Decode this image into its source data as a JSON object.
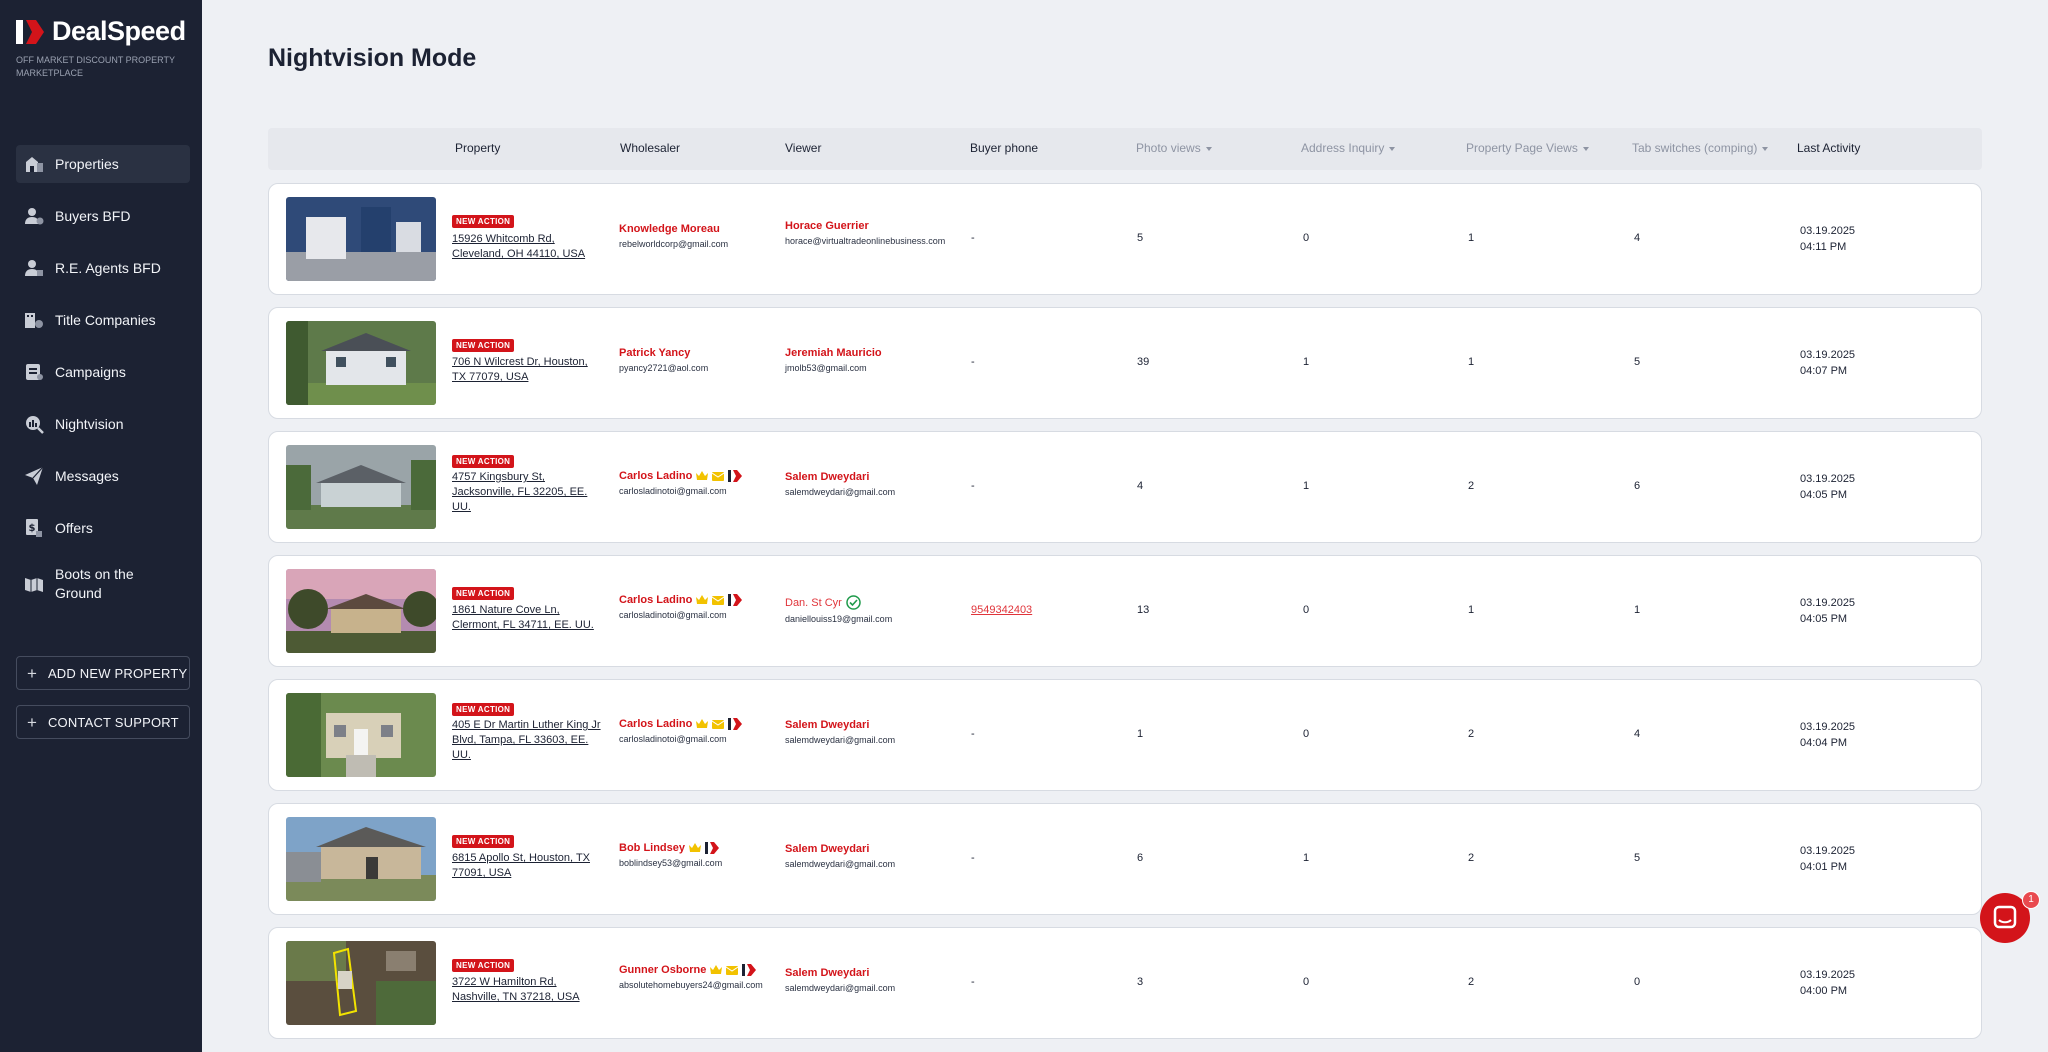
{
  "app": {
    "name": "DealSpeed",
    "tagline": "OFF MARKET DISCOUNT PROPERTY MARKETPLACE",
    "brand_color": "#d3141a",
    "sidebar_color": "#1c2233"
  },
  "sidebar": {
    "items": [
      {
        "label": "Properties",
        "icon": "properties-icon"
      },
      {
        "label": "Buyers BFD",
        "icon": "buyers-icon"
      },
      {
        "label": "R.E. Agents BFD",
        "icon": "agents-icon"
      },
      {
        "label": "Title Companies",
        "icon": "title-companies-icon"
      },
      {
        "label": "Campaigns",
        "icon": "campaigns-icon"
      },
      {
        "label": "Nightvision",
        "icon": "nightvision-icon"
      },
      {
        "label": "Messages",
        "icon": "messages-icon"
      },
      {
        "label": "Offers",
        "icon": "offers-icon"
      },
      {
        "label": "Boots on the Ground",
        "icon": "boots-icon"
      }
    ],
    "add_property": "ADD NEW PROPERTY",
    "contact_support": "CONTACT SUPPORT"
  },
  "page": {
    "title": "Nightvision Mode"
  },
  "table": {
    "headers": {
      "property": "Property",
      "wholesaler": "Wholesaler",
      "viewer": "Viewer",
      "buyer_phone": "Buyer phone",
      "photo_views": "Photo views",
      "address_inquiry": "Address Inquiry",
      "page_views": "Property Page Views",
      "tab_switches": "Tab switches (comping)",
      "last_activity": "Last Activity"
    },
    "rows": [
      {
        "badge": "NEW ACTION",
        "address": "15926 Whitcomb Rd, Cleveland, OH 44110, USA",
        "wholesaler": "Knowledge Moreau",
        "wholesaler_email": "rebelworldcorp@gmail.com",
        "viewer": "Horace Guerrier",
        "viewer_email": "horace@virtualtradeonlinebusiness.com",
        "phone": "-",
        "photo_views": "5",
        "address_inquiry": "0",
        "page_views": "1",
        "tab_switches": "4",
        "date": "03.19.2025",
        "time": "04:11 PM"
      },
      {
        "badge": "NEW ACTION",
        "address": "706 N Wilcrest Dr, Houston, TX 77079, USA",
        "wholesaler": "Patrick Yancy",
        "wholesaler_email": "pyancy2721@aol.com",
        "viewer": "Jeremiah Mauricio",
        "viewer_email": "jmolb53@gmail.com",
        "phone": "-",
        "photo_views": "39",
        "address_inquiry": "1",
        "page_views": "1",
        "tab_switches": "5",
        "date": "03.19.2025",
        "time": "04:07 PM"
      },
      {
        "badge": "NEW ACTION",
        "address": "4757 Kingsbury St, Jacksonville, FL 32205, EE. UU.",
        "wholesaler": "Carlos Ladino",
        "wholesaler_email": "carlosladinotoi@gmail.com",
        "viewer": "Salem Dweydari",
        "viewer_email": "salemdweydari@gmail.com",
        "phone": "-",
        "photo_views": "4",
        "address_inquiry": "1",
        "page_views": "2",
        "tab_switches": "6",
        "date": "03.19.2025",
        "time": "04:05 PM"
      },
      {
        "badge": "NEW ACTION",
        "address": "1861 Nature Cove Ln, Clermont, FL 34711, EE. UU.",
        "wholesaler": "Carlos Ladino",
        "wholesaler_email": "carlosladinotoi@gmail.com",
        "viewer": "Dan. St Cyr",
        "viewer_email": "daniellouiss19@gmail.com",
        "phone": "9549342403",
        "photo_views": "13",
        "address_inquiry": "0",
        "page_views": "1",
        "tab_switches": "1",
        "date": "03.19.2025",
        "time": "04:05 PM"
      },
      {
        "badge": "NEW ACTION",
        "address": "405 E Dr Martin Luther King Jr Blvd, Tampa, FL 33603, EE. UU.",
        "wholesaler": "Carlos Ladino",
        "wholesaler_email": "carlosladinotoi@gmail.com",
        "viewer": "Salem Dweydari",
        "viewer_email": "salemdweydari@gmail.com",
        "phone": "-",
        "photo_views": "1",
        "address_inquiry": "0",
        "page_views": "2",
        "tab_switches": "4",
        "date": "03.19.2025",
        "time": "04:04 PM"
      },
      {
        "badge": "NEW ACTION",
        "address": "6815 Apollo St, Houston, TX 77091, USA",
        "wholesaler": "Bob Lindsey",
        "wholesaler_email": "boblindsey53@gmail.com",
        "viewer": "Salem Dweydari",
        "viewer_email": "salemdweydari@gmail.com",
        "phone": "-",
        "photo_views": "6",
        "address_inquiry": "1",
        "page_views": "2",
        "tab_switches": "5",
        "date": "03.19.2025",
        "time": "04:01 PM"
      },
      {
        "badge": "NEW ACTION",
        "address": "3722 W Hamilton Rd, Nashville, TN 37218, USA",
        "wholesaler": "Gunner Osborne",
        "wholesaler_email": "absolutehomebuyers24@gmail.com",
        "viewer": "Salem Dweydari",
        "viewer_email": "salemdweydari@gmail.com",
        "phone": "-",
        "photo_views": "3",
        "address_inquiry": "0",
        "page_views": "2",
        "tab_switches": "0",
        "date": "03.19.2025",
        "time": "04:00 PM"
      }
    ]
  },
  "chat": {
    "badge": "1"
  }
}
